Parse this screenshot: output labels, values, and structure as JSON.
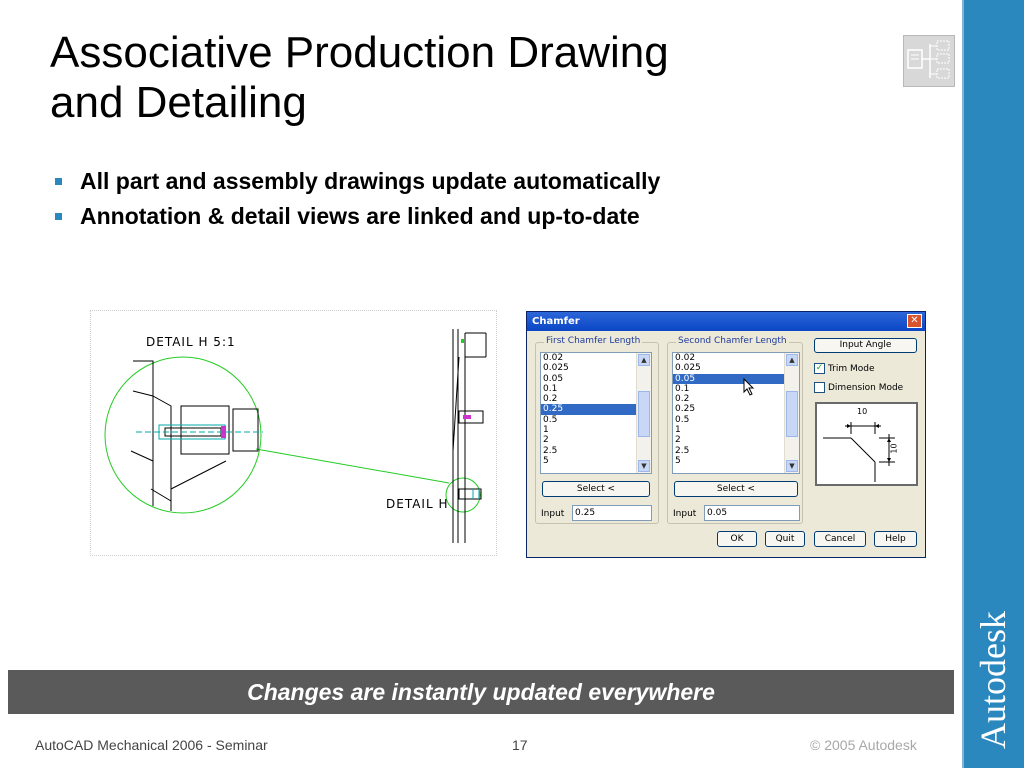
{
  "slide": {
    "title_line1": "Associative Production Drawing",
    "title_line2": "and Detailing",
    "bullets": [
      "All part and assembly drawings update automatically",
      "Annotation & detail views are linked and up-to-date"
    ],
    "banner": "Changes are instantly updated everywhere",
    "footer": {
      "left": "AutoCAD Mechanical 2006 - Seminar",
      "page": "17",
      "right": "© 2005 Autodesk"
    },
    "brand": "Autodesk",
    "accent_color": "#2a88bf",
    "icon": "workflow-diagram-icon"
  },
  "drawing": {
    "detail_title": "DETAIL H  5:1",
    "detail_callout": "DETAIL H"
  },
  "dialog": {
    "title": "Chamfer",
    "close": "✕",
    "first_group": {
      "label": "First Chamfer Length",
      "items": [
        "0.02",
        "0.025",
        "0.05",
        "0.1",
        "0.2",
        "0.25",
        "0.5",
        "1",
        "2",
        "2.5",
        "5"
      ],
      "selected": "0.25",
      "select_button": "Select <",
      "input_label": "Input",
      "input_value": "0.25"
    },
    "second_group": {
      "label": "Second Chamfer Length",
      "items": [
        "0.02",
        "0.025",
        "0.05",
        "0.1",
        "0.2",
        "0.25",
        "0.5",
        "1",
        "2",
        "2.5",
        "5"
      ],
      "selected": "0.05",
      "select_button": "Select <",
      "input_label": "Input",
      "input_value": "0.05"
    },
    "input_angle_button": "Input Angle",
    "trim_mode": {
      "label": "Trim Mode",
      "checked": true
    },
    "dimension_mode": {
      "label": "Dimension Mode",
      "checked": false
    },
    "preview": {
      "dim_top": "10",
      "dim_side": "10"
    },
    "buttons": {
      "ok": "OK",
      "quit": "Quit",
      "cancel": "Cancel",
      "help": "Help"
    }
  }
}
